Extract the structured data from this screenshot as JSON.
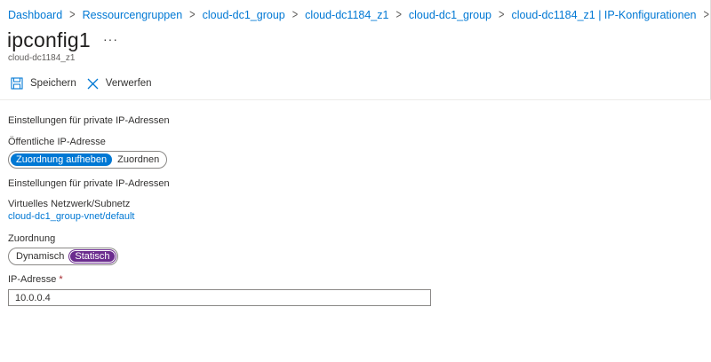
{
  "breadcrumb": [
    "Dashboard",
    "Ressourcengruppen",
    "cloud-dc1_group",
    "cloud-dc1184_z1",
    "cloud-dc1_group",
    "cloud-dc1184_z1 | IP-Konfigurationen"
  ],
  "header": {
    "title": "ipconfig1",
    "more": "···",
    "subtitle": "cloud-dc1184_z1"
  },
  "toolbar": {
    "save_label": "Speichern",
    "discard_label": "Verwerfen"
  },
  "sections": {
    "private_ip_settings_1": "Einstellungen für private IP-Adressen",
    "public_ip_label": "Öffentliche IP-Adresse",
    "public_ip_options": [
      "Zuordnung aufheben",
      "Zuordnen"
    ],
    "public_ip_selected": "Zuordnung aufheben",
    "private_ip_settings_2": "Einstellungen für private IP-Adressen",
    "vnet_label": "Virtuelles Netzwerk/Subnetz",
    "vnet_value": "cloud-dc1_group-vnet/default",
    "assignment_label": "Zuordnung",
    "assignment_options": [
      "Dynamisch",
      "Statisch"
    ],
    "assignment_selected": "Statisch",
    "ip_label": "IP-Adresse",
    "ip_required_mark": "*",
    "ip_value": "10.0.0.4"
  },
  "colors": {
    "link": "#0078d4",
    "toggle_public_selected": "#0078d4",
    "toggle_assign_selected": "#6b2c8e",
    "required": "#a4262c"
  },
  "icons": {
    "save": "save-icon",
    "discard": "close-icon",
    "breadcrumb_sep": "chevron-right-icon"
  }
}
